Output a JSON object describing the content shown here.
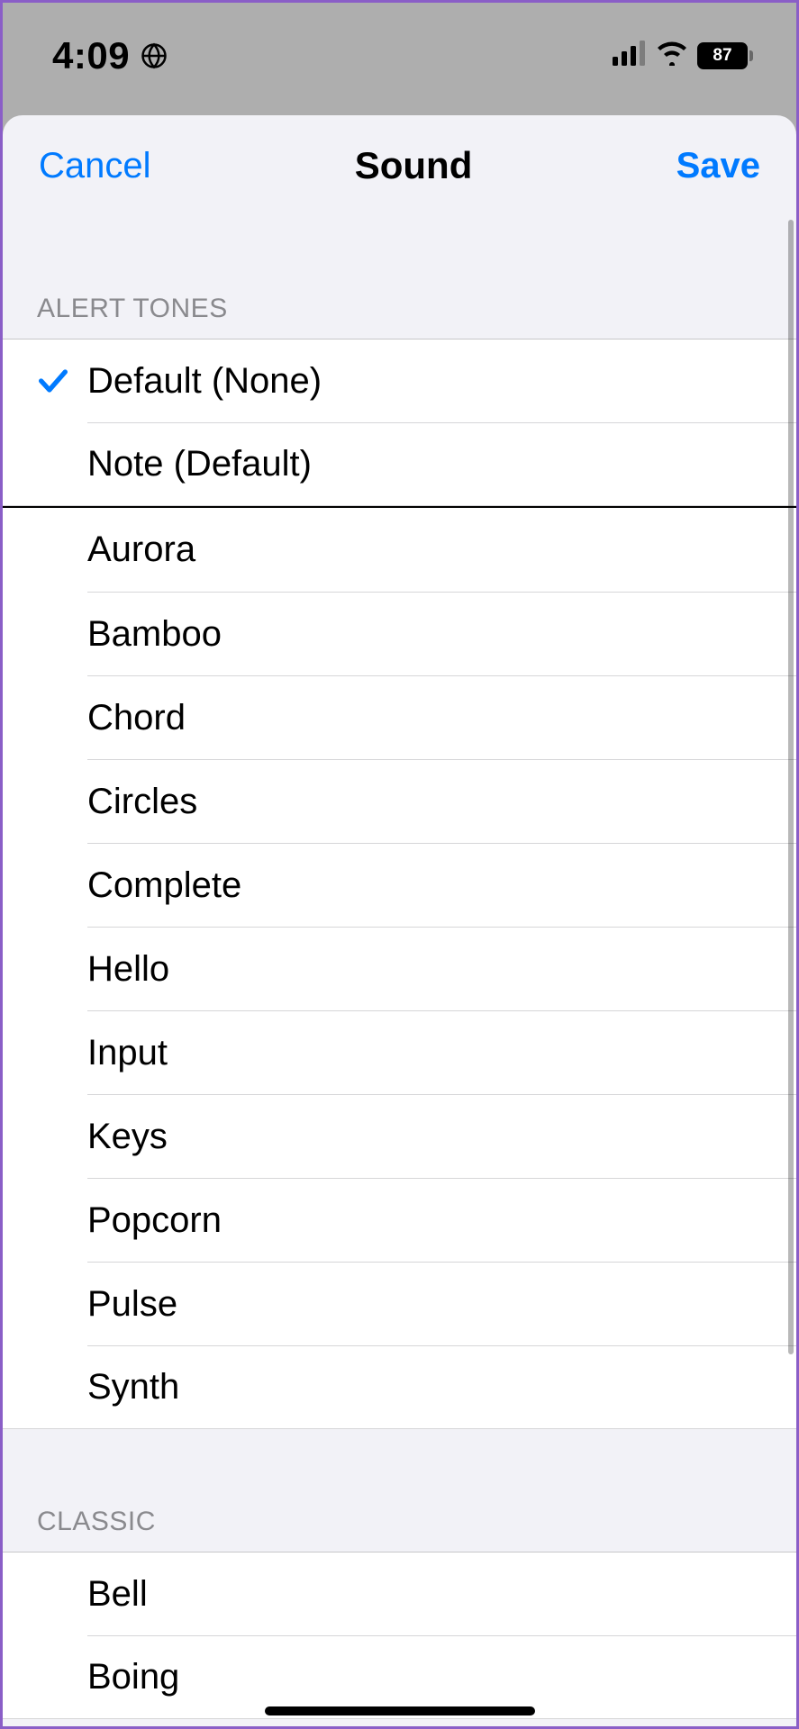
{
  "status": {
    "time": "4:09",
    "battery_percent": "87"
  },
  "header": {
    "cancel": "Cancel",
    "title": "Sound",
    "save": "Save"
  },
  "sections": {
    "alert_tones_header": "ALERT TONES",
    "classic_header": "CLASSIC"
  },
  "alert_tones": {
    "selected_index": 0,
    "items": [
      "Default (None)",
      "Note (Default)",
      "Aurora",
      "Bamboo",
      "Chord",
      "Circles",
      "Complete",
      "Hello",
      "Input",
      "Keys",
      "Popcorn",
      "Pulse",
      "Synth"
    ]
  },
  "classic": {
    "items": [
      "Bell",
      "Boing"
    ]
  }
}
